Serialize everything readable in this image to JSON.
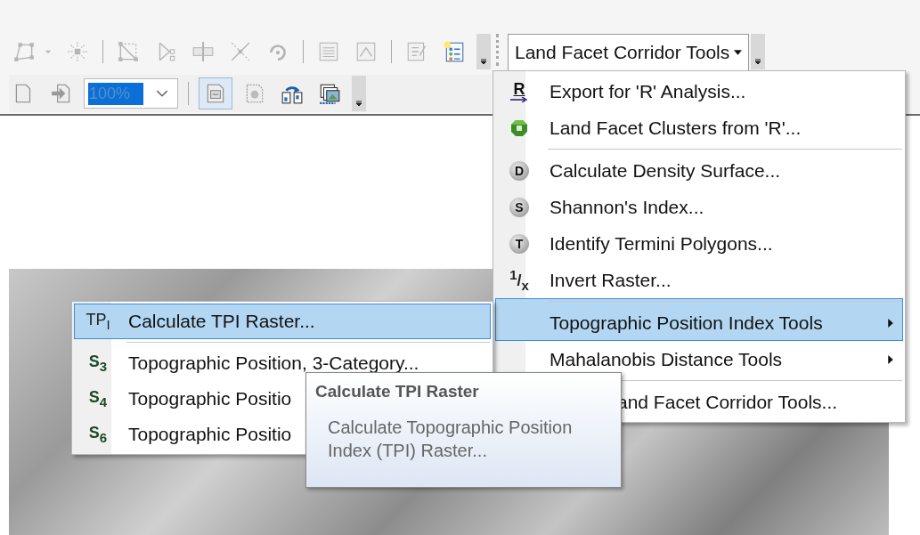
{
  "toolbar": {
    "row_1": [
      {
        "kind": "polygon",
        "disabled": true
      },
      {
        "kind": "caret",
        "disabled": true
      },
      {
        "kind": "explode",
        "disabled": true
      },
      {
        "kind": "sep"
      },
      {
        "kind": "reshape",
        "disabled": true
      },
      {
        "kind": "trim",
        "disabled": true
      },
      {
        "kind": "split",
        "disabled": true
      },
      {
        "kind": "intersect",
        "disabled": true
      },
      {
        "kind": "rotate",
        "disabled": true
      },
      {
        "kind": "sep"
      },
      {
        "kind": "table",
        "disabled": true
      },
      {
        "kind": "sketch",
        "disabled": true
      },
      {
        "kind": "sep"
      },
      {
        "kind": "properties",
        "disabled": true
      },
      {
        "kind": "legend",
        "disabled": false
      },
      {
        "kind": "overflow"
      }
    ],
    "row_2": [
      {
        "kind": "page",
        "pressed": false
      },
      {
        "kind": "export",
        "pressed": false
      },
      {
        "kind": "zoom",
        "value": "100%"
      },
      {
        "kind": "sep"
      },
      {
        "kind": "layout",
        "pressed": true
      },
      {
        "kind": "page-setup",
        "pressed": false
      },
      {
        "kind": "refresh",
        "pressed": false
      },
      {
        "kind": "overview",
        "pressed": false
      },
      {
        "kind": "overflow"
      }
    ],
    "dropdown": {
      "label": "Land Facet Corridor Tools",
      "expanded": true
    }
  },
  "menu": {
    "items": [
      {
        "kind": "r-arrow",
        "icon_text": "R",
        "label": "Export for 'R' Analysis...",
        "selected": false,
        "separator_above": false,
        "has_submenu": false
      },
      {
        "kind": "octagon",
        "label": "Land Facet Clusters from 'R'...",
        "selected": false,
        "separator_above": false,
        "has_submenu": false
      },
      {
        "kind": "badge",
        "icon_text": "D",
        "label": "Calculate Density Surface...",
        "selected": false,
        "separator_above": true,
        "has_submenu": false
      },
      {
        "kind": "badge",
        "icon_text": "S",
        "label": "Shannon's Index...",
        "selected": false,
        "separator_above": false,
        "has_submenu": false
      },
      {
        "kind": "badge",
        "icon_text": "T",
        "label": "Identify Termini Polygons...",
        "selected": false,
        "separator_above": false,
        "has_submenu": false
      },
      {
        "kind": "fraction",
        "icon_text": "$^{1}$/$_{x}$",
        "label": "Invert Raster...",
        "selected": false,
        "separator_above": false,
        "has_submenu": false
      },
      {
        "label": "Topographic Position Index Tools",
        "selected": true,
        "separator_above": true,
        "has_submenu": true
      },
      {
        "label": "Mahalanobis Distance Tools",
        "selected": false,
        "separator_above": false,
        "has_submenu": true
      },
      {
        "label": "and Facet Corridor Tools...",
        "selected": false,
        "separator_above": true,
        "has_submenu": false,
        "covered_start": true
      }
    ]
  },
  "submenu": {
    "items": [
      {
        "icon_text": "TP$_{I}$",
        "label": "Calculate TPI Raster...",
        "selected": true,
        "separator_above": false
      },
      {
        "icon_text": "S$_{3}$",
        "label": "Topographic Position, 3-Category...",
        "selected": false,
        "separator_above": true
      },
      {
        "icon_text": "S$_{4}$",
        "label": "Topographic Positio",
        "selected": false,
        "separator_above": false
      },
      {
        "icon_text": "S$_{6}$",
        "label": "Topographic Positio",
        "selected": false,
        "separator_above": false
      }
    ]
  },
  "tooltip": {
    "title": "Calculate TPI Raster",
    "text": "Calculate Topographic Position Index (TPI) Raster..."
  }
}
